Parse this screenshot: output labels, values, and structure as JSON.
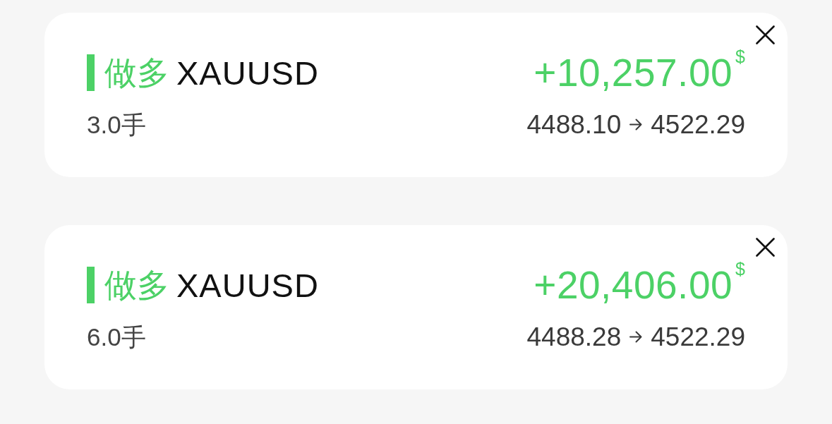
{
  "positions": [
    {
      "side": "做多",
      "symbol": "XAUUSD",
      "lots": "3.0手",
      "profit": "+10,257.00",
      "currency": "$",
      "open_price": "4488.10",
      "close_price": "4522.29"
    },
    {
      "side": "做多",
      "symbol": "XAUUSD",
      "lots": "6.0手",
      "profit": "+20,406.00",
      "currency": "$",
      "open_price": "4488.28",
      "close_price": "4522.29"
    }
  ]
}
